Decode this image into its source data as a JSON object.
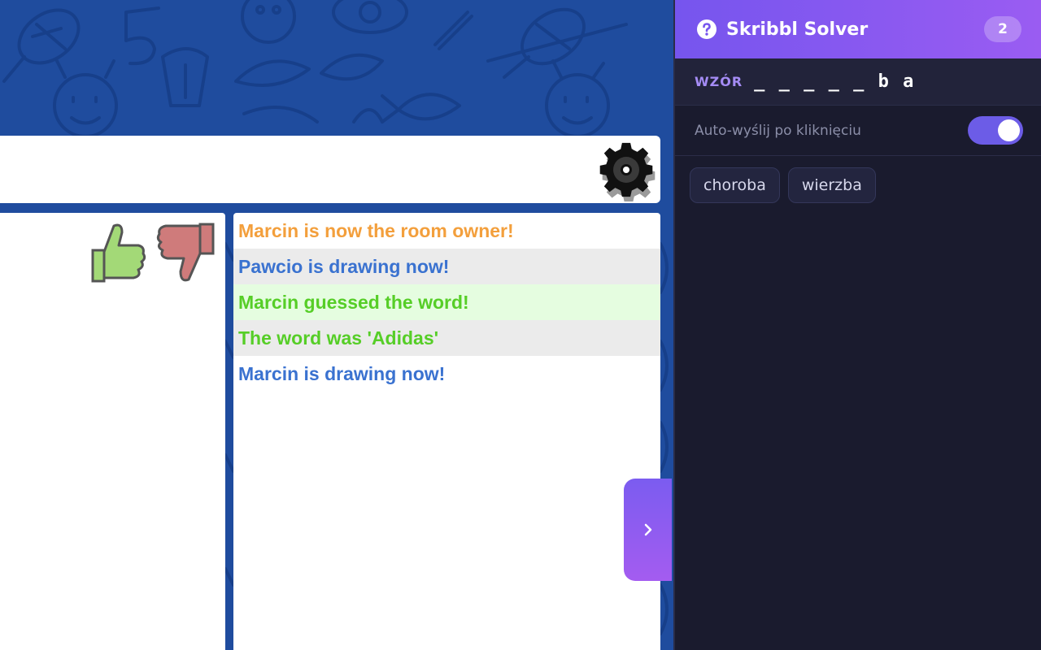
{
  "chat": {
    "messages": [
      {
        "text": "Marcin is now the room owner!",
        "color": "#f39f3c"
      },
      {
        "text": "Pawcio is drawing now!",
        "color": "#3a72d0"
      },
      {
        "text": "Marcin guessed the word!",
        "color": "#56ce27"
      },
      {
        "text": "The word was 'Adidas'",
        "color": "#56ce27"
      },
      {
        "text": "Marcin is drawing now!",
        "color": "#3a72d0"
      }
    ]
  },
  "icons": {
    "settings": "gear-icon",
    "like": "thumbs-up-icon",
    "dislike": "thumbs-down-icon",
    "panel_toggle": "chevron-right-icon",
    "help": "question-circle-icon"
  },
  "solver": {
    "title": "Skribbl Solver",
    "count": "2",
    "pattern_label": "WZÓR",
    "pattern_value": "_ _ _ _ _ b a",
    "auto_send_label": "Auto-wyślij po kliknięciu",
    "auto_send_enabled": true,
    "words": [
      "choroba",
      "wierzba"
    ]
  },
  "colors": {
    "accent": "#7655ee",
    "panel_bg": "#1a1b2e",
    "game_bg": "#1f4c9e"
  }
}
